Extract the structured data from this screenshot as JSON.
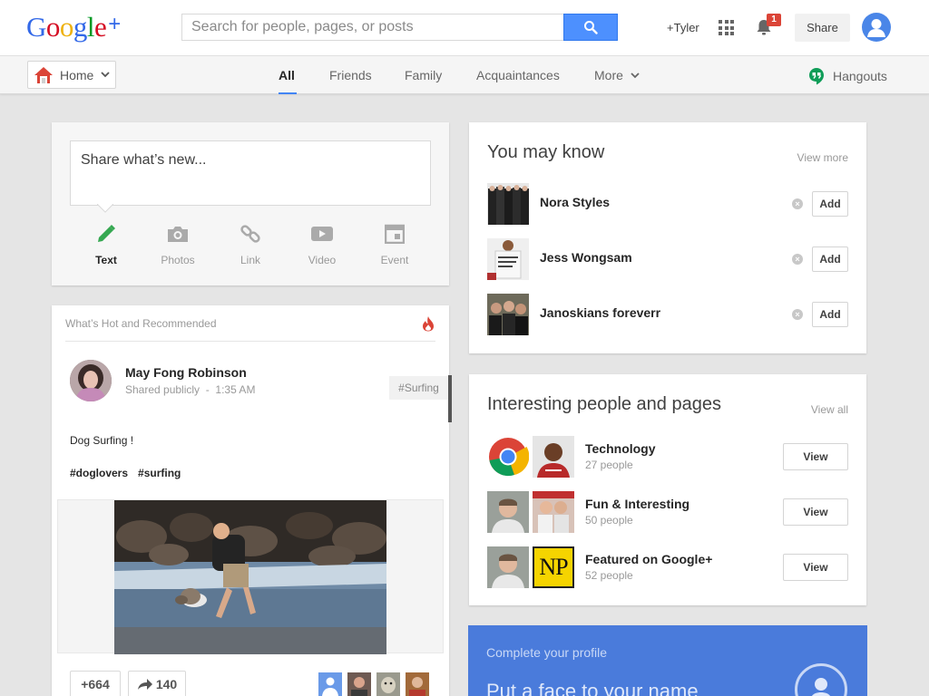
{
  "header": {
    "logo_text": "Google",
    "logo_plus": "+",
    "search_placeholder": "Search for people, pages, or posts",
    "username": "+Tyler",
    "notification_count": "1",
    "share_label": "Share"
  },
  "nav": {
    "home_label": "Home",
    "tabs": [
      "All",
      "Friends",
      "Family",
      "Acquaintances",
      "More"
    ],
    "active_tab": "All",
    "hangouts_label": "Hangouts"
  },
  "share_box": {
    "placeholder": "Share what’s new...",
    "tools": [
      "Text",
      "Photos",
      "Link",
      "Video",
      "Event"
    ]
  },
  "post": {
    "section_label": "What’s Hot and Recommended",
    "author": "May Fong Robinson",
    "visibility": "Shared publicly",
    "time": "1:35 AM",
    "tag": "#Surfing",
    "text": "Dog Surfing !",
    "hashtags": [
      "#doglovers",
      "#surfing"
    ],
    "plus_count": "+664",
    "reshare_count": "140"
  },
  "you_may_know": {
    "title": "You may know",
    "view_more": "View more",
    "add_label": "Add",
    "people": [
      {
        "name": "Nora Styles"
      },
      {
        "name": "Jess Wongsam"
      },
      {
        "name": "Janoskians foreverr"
      }
    ]
  },
  "interesting": {
    "title": "Interesting people and pages",
    "view_all": "View all",
    "view_label": "View",
    "pages": [
      {
        "name": "Technology",
        "count": "27 people"
      },
      {
        "name": "Fun & Interesting",
        "count": "50 people"
      },
      {
        "name": "Featured on Google+",
        "count": "52 people",
        "logo": "NP"
      }
    ]
  },
  "profile_prompt": {
    "subtitle": "Complete your profile",
    "headline": "Put a face to your name"
  },
  "colors": {
    "accent_blue": "#4d90fe",
    "tab_underline": "#4285f4",
    "hangouts_green": "#0f9d58",
    "notification_red": "#db4437",
    "profile_banner": "#4a7bdb"
  }
}
